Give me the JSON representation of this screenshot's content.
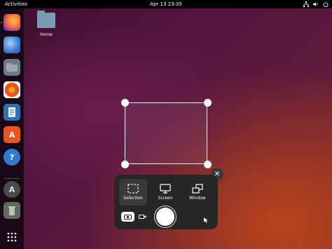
{
  "topbar": {
    "activities_label": "Activities",
    "clock": "Apr 13  23:35",
    "tray_icons": [
      "network-icon",
      "volume-icon",
      "power-icon"
    ]
  },
  "desktop": {
    "home_label": "Home"
  },
  "dock": {
    "apps": [
      "firefox-icon",
      "thunderbird-icon",
      "files-icon",
      "rhythmbox-icon",
      "writer-icon",
      "app-center-icon",
      "help-icon",
      "software-updater-icon",
      "trash-icon",
      "show-apps-icon"
    ]
  },
  "screenshot_ui": {
    "modes": [
      {
        "label": "Selection",
        "icon": "selection-icon",
        "active": true
      },
      {
        "label": "Screen",
        "icon": "screen-icon",
        "active": false
      },
      {
        "label": "Window",
        "icon": "window-icon",
        "active": false
      }
    ],
    "capture_type": "screenshot",
    "colors": {
      "panel": "#262626",
      "accent": "#e95420"
    }
  }
}
